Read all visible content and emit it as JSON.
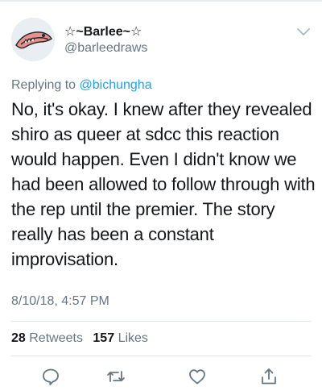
{
  "user": {
    "display_name": "☆~Barlee~☆",
    "handle": "@barleedraws",
    "avatar_icon": "avatar-fox-icon"
  },
  "reply": {
    "prefix": "Replying to",
    "mention": "@bichungha"
  },
  "tweet": {
    "text": "No, it's okay. I knew after they revealed shiro as queer at sdcc this reaction would happen. Even I didn't know we had been allowed to follow through with the rep until the premier. The story really has been a constant improvisation.",
    "timestamp": "8/10/18, 4:57 PM"
  },
  "stats": {
    "retweets_count": "28",
    "retweets_label": "Retweets",
    "likes_count": "157",
    "likes_label": "Likes"
  },
  "actions": [
    "reply-icon",
    "retweet-icon",
    "like-icon",
    "share-icon"
  ],
  "colors": {
    "text": "#14171a",
    "secondary": "#657786",
    "link": "#1da1f2",
    "icon": "#657786",
    "divider": "#e1e8ed"
  }
}
